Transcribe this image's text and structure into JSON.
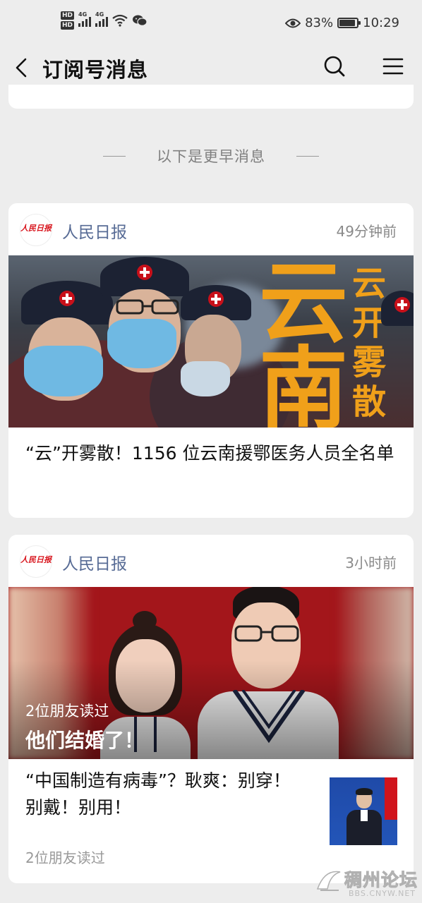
{
  "status_bar": {
    "hd1": "HD",
    "hd2": "HD",
    "net1": "4G",
    "net2": "4G",
    "battery_percent": "83%",
    "battery_level": 0.83,
    "time": "10:29"
  },
  "nav": {
    "title": "订阅号消息",
    "back_icon": "chevron-left-icon",
    "search_icon": "search-icon",
    "menu_icon": "menu-icon"
  },
  "divider": {
    "text": "以下是更早消息"
  },
  "cards": [
    {
      "account": "人民日报",
      "logo_text": "人民日报",
      "time": "49分钟前",
      "cover_text_main": "云南",
      "cover_text_side": "云开雾散",
      "title": "“云”开雾散！1156 位云南援鄂医务人员全名单"
    },
    {
      "account": "人民日报",
      "logo_text": "人民日报",
      "time": "3小时前",
      "cover_overlay_read": "2位朋友读过",
      "cover_headline": "他们结婚了！",
      "item_title": "“中国制造有病毒”？耿爽：别穿！别戴！别用！",
      "item_meta": "2位朋友读过"
    }
  ],
  "watermark": {
    "title": "稠州论坛",
    "subtitle": "BBS.CNYW.NET"
  },
  "colors": {
    "background": "#ededed",
    "account_name": "#576b95",
    "accent_orange": "#f0a01a",
    "logo_red": "#d8141c"
  }
}
